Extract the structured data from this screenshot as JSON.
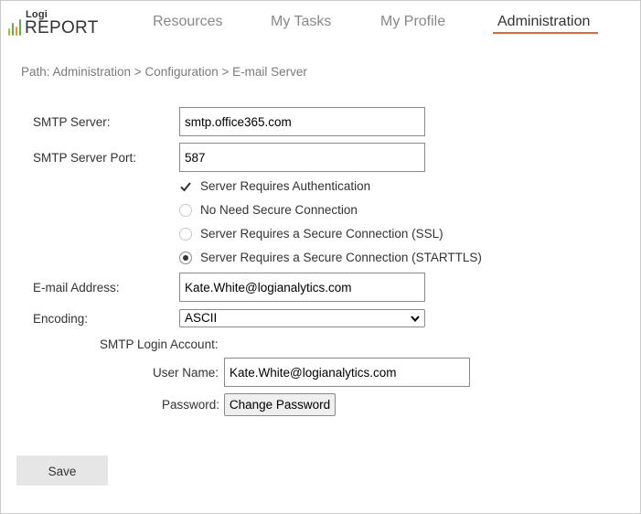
{
  "logo": {
    "small_text": "Logi",
    "big_text": "REPORT",
    "bar_colors": [
      "#8cc63f",
      "#6aa84f",
      "#f7941d",
      "#6aa84f"
    ]
  },
  "nav": {
    "items": [
      {
        "label": "Resources"
      },
      {
        "label": "My Tasks"
      },
      {
        "label": "My Profile"
      },
      {
        "label": "Administration"
      }
    ],
    "active_index": 3,
    "accent_color": "#e8643c"
  },
  "breadcrumb": "Path: Administration > Configuration > E-mail Server",
  "form": {
    "smtp_server": {
      "label": "SMTP Server:",
      "value": "smtp.office365.com"
    },
    "smtp_port": {
      "label": "SMTP Server Port:",
      "value": "587"
    },
    "options": [
      {
        "type": "checkbox",
        "label": "Server Requires Authentication",
        "checked": true
      },
      {
        "type": "radio",
        "label": "No Need Secure Connection",
        "checked": false
      },
      {
        "type": "radio",
        "label": "Server Requires a Secure Connection (SSL)",
        "checked": false
      },
      {
        "type": "radio",
        "label": "Server Requires a Secure Connection (STARTTLS)",
        "checked": true
      }
    ],
    "email_address": {
      "label": "E-mail Address:",
      "value": "Kate.White@logianalytics.com"
    },
    "encoding": {
      "label": "Encoding:",
      "value": "ASCII"
    },
    "login_account_label": "SMTP Login Account:",
    "user_name": {
      "label": "User Name:",
      "value": "Kate.White@logianalytics.com"
    },
    "password": {
      "label": "Password:",
      "button_label": "Change Password"
    }
  },
  "save_label": "Save"
}
